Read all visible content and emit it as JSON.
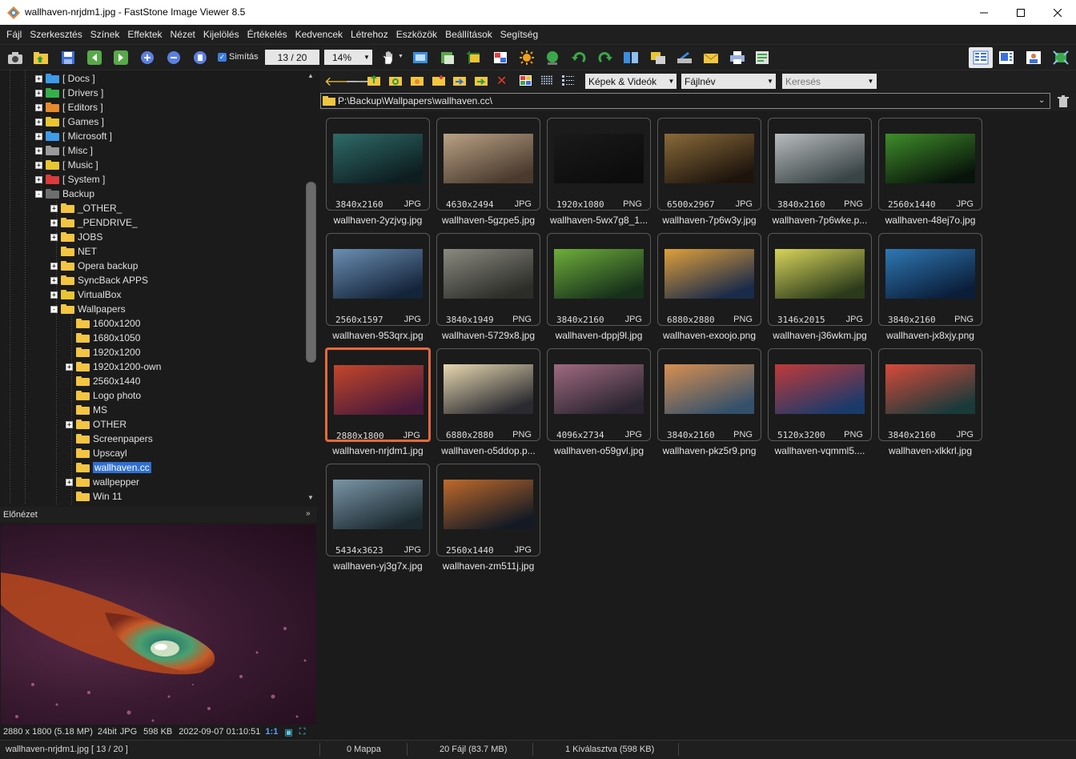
{
  "window": {
    "title": "wallhaven-nrjdm1.jpg  -  FastStone Image Viewer 8.5"
  },
  "menu": [
    "Fájl",
    "Szerkesztés",
    "Színek",
    "Effektek",
    "Nézet",
    "Kijelölés",
    "Értékelés",
    "Kedvencek",
    "Létrehoz",
    "Eszközök",
    "Beállítások",
    "Segítség"
  ],
  "toolbar": {
    "smoothing_label": "Simítás",
    "smoothing_checked": true,
    "position": "13 / 20",
    "zoom": "14%"
  },
  "tree": {
    "items": [
      {
        "label": "[ Docs ]",
        "expander": "+",
        "color": "#3d9be8"
      },
      {
        "label": "[ Drivers ]",
        "expander": "+",
        "color": "#34b04a"
      },
      {
        "label": "[ Editors ]",
        "expander": "+",
        "color": "#e68a2e"
      },
      {
        "label": "[ Games ]",
        "expander": "+",
        "color": "#e8c531"
      },
      {
        "label": "[ Microsoft ]",
        "expander": "+",
        "color": "#3d9be8"
      },
      {
        "label": "[ Misc ]",
        "expander": "+",
        "color": "#9a9a9a"
      },
      {
        "label": "[ Music ]",
        "expander": "+",
        "color": "#e8c531"
      },
      {
        "label": "[ System ]",
        "expander": "+",
        "color": "#d93b3b"
      },
      {
        "label": "Backup",
        "expander": "-",
        "color": "#6e6e6e"
      },
      {
        "label": "_OTHER_",
        "expander": "+",
        "color": "#f4c542"
      },
      {
        "label": "_PENDRIVE_",
        "expander": "+",
        "color": "#f4c542"
      },
      {
        "label": "JOBS",
        "expander": "+",
        "color": "#f4c542"
      },
      {
        "label": "NET",
        "expander": "",
        "color": "#f4c542"
      },
      {
        "label": "Opera backup",
        "expander": "+",
        "color": "#f4c542"
      },
      {
        "label": "SyncBack APPS",
        "expander": "+",
        "color": "#f4c542"
      },
      {
        "label": "VirtualBox",
        "expander": "+",
        "color": "#e8c531"
      },
      {
        "label": "Wallpapers",
        "expander": "-",
        "color": "#f4c542"
      },
      {
        "label": "1600x1200",
        "expander": "",
        "color": "#f4c542"
      },
      {
        "label": "1680x1050",
        "expander": "",
        "color": "#f4c542"
      },
      {
        "label": "1920x1200",
        "expander": "",
        "color": "#f4c542"
      },
      {
        "label": "1920x1200-own",
        "expander": "+",
        "color": "#f4c542"
      },
      {
        "label": "2560x1440",
        "expander": "",
        "color": "#f4c542"
      },
      {
        "label": "Logo photo",
        "expander": "",
        "color": "#f4c542"
      },
      {
        "label": "MS",
        "expander": "",
        "color": "#f4c542"
      },
      {
        "label": "OTHER",
        "expander": "+",
        "color": "#f4c542"
      },
      {
        "label": "Screenpapers",
        "expander": "",
        "color": "#f4c542"
      },
      {
        "label": "Upscayl",
        "expander": "",
        "color": "#f4c542"
      },
      {
        "label": "wallhaven.cc",
        "expander": "",
        "color": "#f4c542",
        "selected": true
      },
      {
        "label": "wallpepper",
        "expander": "+",
        "color": "#f4c542"
      },
      {
        "label": "Win 11",
        "expander": "",
        "color": "#f4c542"
      }
    ]
  },
  "preview": {
    "header": "Előnézet",
    "info": {
      "dimensions": "2880 x 1800 (5.18 MP)",
      "bits": "24bit",
      "format": "JPG",
      "size": "598 KB",
      "datetime": "2022-09-07 01:10:51",
      "ratio": "1:1"
    }
  },
  "browser": {
    "filter": "Képek & Videók",
    "sort": "Fájlnév",
    "search_placeholder": "Keresés",
    "path": "P:\\Backup\\Wallpapers\\wallhaven.cc\\"
  },
  "thumbnails": [
    {
      "name": "wallhaven-2yzjvg.jpg",
      "dim": "3840x2160",
      "fmt": "JPG",
      "c1": "#2f6b68",
      "c2": "#0d1d20"
    },
    {
      "name": "wallhaven-5gzpe5.jpg",
      "dim": "4630x2494",
      "fmt": "JPG",
      "c1": "#b9a184",
      "c2": "#4a3a2e"
    },
    {
      "name": "wallhaven-5wx7g8_1...",
      "dim": "1920x1080",
      "fmt": "PNG",
      "c1": "#1a1a1a",
      "c2": "#0c0c0c"
    },
    {
      "name": "wallhaven-7p6w3y.jpg",
      "dim": "6500x2967",
      "fmt": "JPG",
      "c1": "#8a6a3a",
      "c2": "#1d140c"
    },
    {
      "name": "wallhaven-7p6wke.p...",
      "dim": "3840x2160",
      "fmt": "PNG",
      "c1": "#b8bcbe",
      "c2": "#3a4446"
    },
    {
      "name": "wallhaven-48ej7o.jpg",
      "dim": "2560x1440",
      "fmt": "JPG",
      "c1": "#3f8d2a",
      "c2": "#08140a"
    },
    {
      "name": "wallhaven-953qrx.jpg",
      "dim": "2560x1597",
      "fmt": "JPG",
      "c1": "#6c8fb4",
      "c2": "#14243a"
    },
    {
      "name": "wallhaven-5729x8.jpg",
      "dim": "3840x1949",
      "fmt": "PNG",
      "c1": "#8a8a80",
      "c2": "#2c2c28"
    },
    {
      "name": "wallhaven-dppj9l.jpg",
      "dim": "3840x2160",
      "fmt": "JPG",
      "c1": "#6fae3a",
      "c2": "#16301a"
    },
    {
      "name": "wallhaven-exoojo.png",
      "dim": "6880x2880",
      "fmt": "PNG",
      "c1": "#e0a03a",
      "c2": "#1a2a4a"
    },
    {
      "name": "wallhaven-j36wkm.jpg",
      "dim": "3146x2015",
      "fmt": "JPG",
      "c1": "#d8d45a",
      "c2": "#2a3a1a"
    },
    {
      "name": "wallhaven-jx8xjy.png",
      "dim": "3840x2160",
      "fmt": "PNG",
      "c1": "#2f78b4",
      "c2": "#0a1e3a"
    },
    {
      "name": "wallhaven-nrjdm1.jpg",
      "dim": "2880x1800",
      "fmt": "JPG",
      "c1": "#c4462a",
      "c2": "#4a1a3a",
      "selected": true
    },
    {
      "name": "wallhaven-o5ddop.p...",
      "dim": "6880x2880",
      "fmt": "PNG",
      "c1": "#e8d8b0",
      "c2": "#2a2a30"
    },
    {
      "name": "wallhaven-o59gvl.jpg",
      "dim": "4096x2734",
      "fmt": "JPG",
      "c1": "#a06a80",
      "c2": "#2a2430"
    },
    {
      "name": "wallhaven-pkz5r9.png",
      "dim": "3840x2160",
      "fmt": "PNG",
      "c1": "#d89050",
      "c2": "#34506a"
    },
    {
      "name": "wallhaven-vqmml5....",
      "dim": "5120x3200",
      "fmt": "PNG",
      "c1": "#c03a3a",
      "c2": "#1a3a6a"
    },
    {
      "name": "wallhaven-xlkkrl.jpg",
      "dim": "3840x2160",
      "fmt": "JPG",
      "c1": "#d84a3a",
      "c2": "#1a3a3a"
    },
    {
      "name": "wallhaven-yj3g7x.jpg",
      "dim": "5434x3623",
      "fmt": "JPG",
      "c1": "#7a96a8",
      "c2": "#1c2a30"
    },
    {
      "name": "wallhaven-zm511j.jpg",
      "dim": "2560x1440",
      "fmt": "JPG",
      "c1": "#c06a2a",
      "c2": "#141a24"
    }
  ],
  "status": {
    "file": "wallhaven-nrjdm1.jpg [ 13 / 20 ]",
    "folders": "0 Mappa",
    "files": "20 Fájl (83.7 MB)",
    "selected": "1 Kiválasztva (598 KB)"
  },
  "colors": {
    "accent": "#e56a3a",
    "selection": "#2f6fd1",
    "background": "#1b1b1b"
  }
}
